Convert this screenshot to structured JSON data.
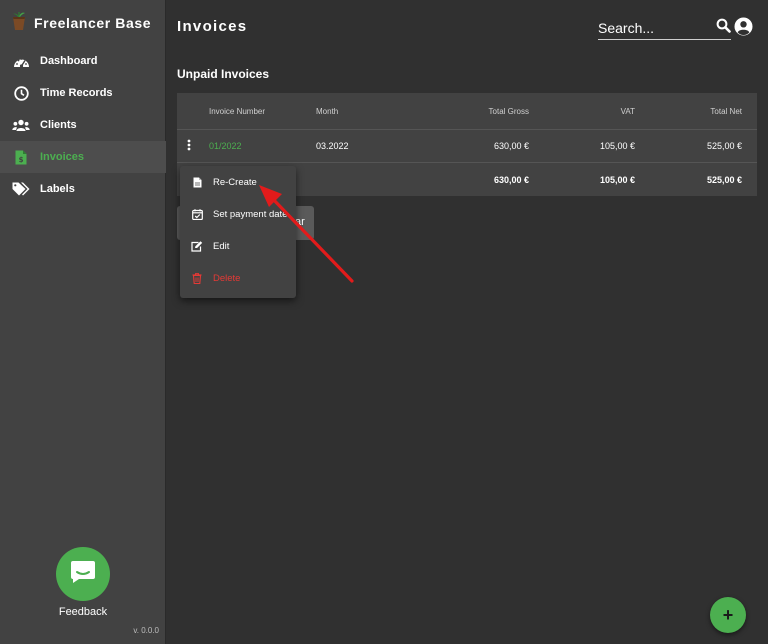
{
  "app": {
    "brand": "Freelancer Base",
    "version": "v. 0.0.0",
    "accent_color": "#4caf50",
    "danger_color": "#e53935"
  },
  "sidebar": {
    "items": [
      {
        "label": "Dashboard",
        "icon": "dashboard-gauge-icon",
        "active": false
      },
      {
        "label": "Time Records",
        "icon": "clock-icon",
        "active": false
      },
      {
        "label": "Clients",
        "icon": "users-icon",
        "active": false
      },
      {
        "label": "Invoices",
        "icon": "invoice-icon",
        "active": true
      },
      {
        "label": "Labels",
        "icon": "tags-icon",
        "active": false
      }
    ],
    "feedback_label": "Feedback"
  },
  "header": {
    "title": "Invoices",
    "search_placeholder": "Search..."
  },
  "section": {
    "title": "Unpaid Invoices"
  },
  "table": {
    "columns": [
      "Invoice Number",
      "Month",
      "Total Gross",
      "VAT",
      "Total Net"
    ],
    "rows": [
      {
        "number": "01/2022",
        "month": "03.2022",
        "gross": "630,00 €",
        "vat": "105,00 €",
        "net": "525,00 €"
      }
    ],
    "totals": {
      "gross": "630,00 €",
      "vat": "105,00 €",
      "net": "525,00 €"
    }
  },
  "context_menu": {
    "items": [
      {
        "label": "Re-Create",
        "icon": "document-icon"
      },
      {
        "label": "Set payment date",
        "icon": "calendar-check-icon"
      },
      {
        "label": "Edit",
        "icon": "edit-icon"
      },
      {
        "label": "Delete",
        "icon": "trash-icon",
        "danger": true
      }
    ]
  },
  "tooltip": {
    "visible_text": "ar"
  },
  "fab": {
    "label": "+"
  }
}
